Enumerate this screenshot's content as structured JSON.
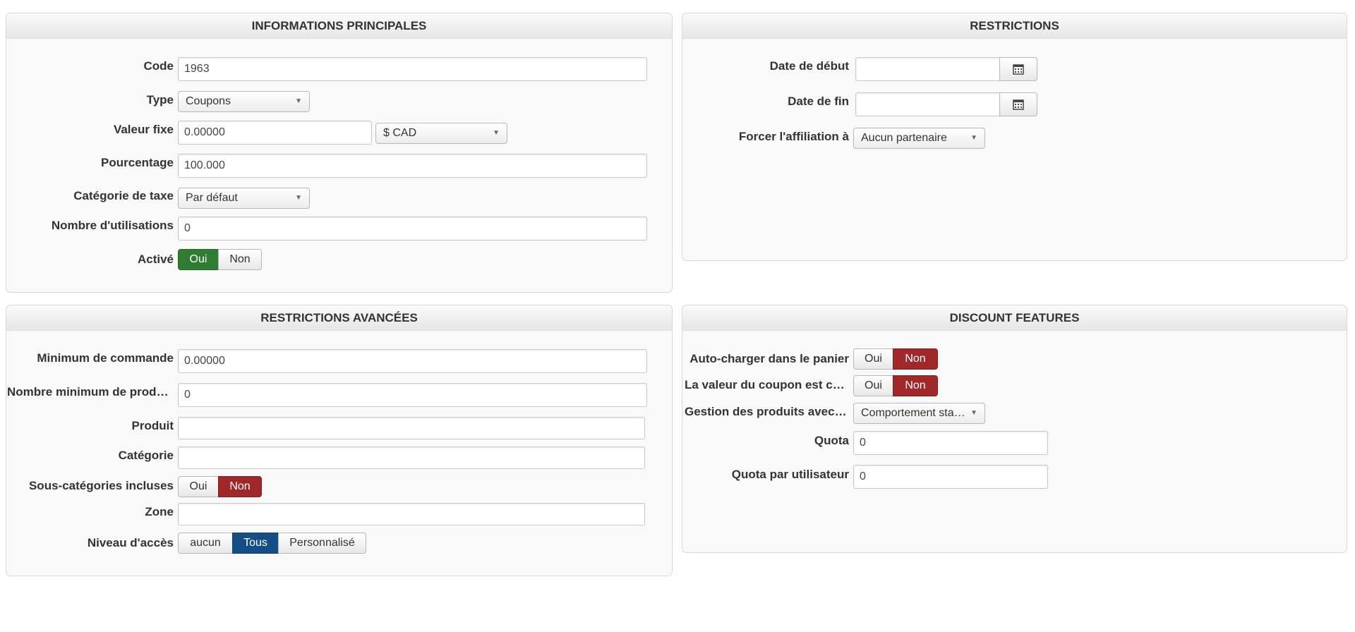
{
  "panels": {
    "main_info": {
      "title": "INFORMATIONS PRINCIPALES",
      "code_label": "Code",
      "code_value": "1963",
      "type_label": "Type",
      "type_value": "Coupons",
      "fixed_value_label": "Valeur fixe",
      "fixed_value": "0.00000",
      "currency_value": "$ CAD",
      "percentage_label": "Pourcentage",
      "percentage_value": "100.000",
      "tax_category_label": "Catégorie de taxe",
      "tax_category_value": "Par défaut",
      "uses_label": "Nombre d'utilisations",
      "uses_value": "0",
      "active_label": "Activé",
      "active_yes": "Oui",
      "active_no": "Non",
      "active_selected": "Oui"
    },
    "restrictions": {
      "title": "RESTRICTIONS",
      "start_date_label": "Date de début",
      "start_date_value": "",
      "end_date_label": "Date de fin",
      "end_date_value": "",
      "affiliation_label": "Forcer l'affiliation à",
      "affiliation_value": "Aucun partenaire"
    },
    "advanced": {
      "title": "RESTRICTIONS AVANCÉES",
      "min_order_label": "Minimum de commande",
      "min_order_value": "0.00000",
      "min_products_label": "Nombre minimum de produits",
      "min_products_value": "0",
      "product_label": "Produit",
      "product_value": "",
      "category_label": "Catégorie",
      "category_value": "",
      "subcats_label": "Sous-catégories incluses",
      "subcats_yes": "Oui",
      "subcats_no": "Non",
      "subcats_selected": "Non",
      "zone_label": "Zone",
      "zone_value": "",
      "access_label": "Niveau d'accès",
      "access_options": [
        "aucun",
        "Tous",
        "Personnalisé"
      ],
      "access_selected": "Tous"
    },
    "discount": {
      "title": "DISCOUNT FEATURES",
      "auto_cart_label": "Auto-charger dans le panier",
      "auto_cart_yes": "Oui",
      "auto_cart_no": "Non",
      "coupon_value_label": "La valeur du coupon est cumulable",
      "coupon_value_yes": "Oui",
      "coupon_value_no": "Non",
      "product_mgmt_label": "Gestion des produits avec remise",
      "product_mgmt_value": "Comportement standard",
      "quota_label": "Quota",
      "quota_value": "0",
      "quota_user_label": "Quota par utilisateur",
      "quota_user_value": "0"
    }
  },
  "colors": {
    "active_green": "#2e7d32",
    "inactive_red": "#a12828",
    "selected_blue": "#154e87"
  },
  "icons": {
    "calendar": "calendar-icon",
    "dropdown": "chevron-down-icon"
  }
}
